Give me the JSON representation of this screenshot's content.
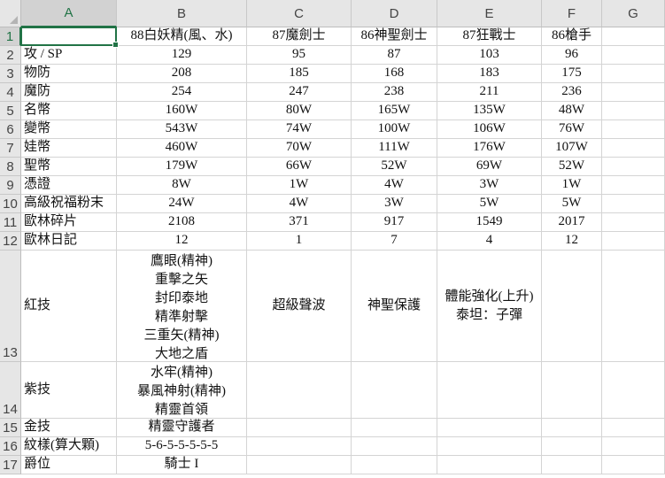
{
  "columns": [
    "A",
    "B",
    "C",
    "D",
    "E",
    "F",
    "G"
  ],
  "rows": [
    "1",
    "2",
    "3",
    "4",
    "5",
    "6",
    "7",
    "8",
    "9",
    "10",
    "11",
    "12",
    "13",
    "14",
    "15",
    "16",
    "17"
  ],
  "active_cell": "A1",
  "headers": [
    "",
    "88白妖精(風、水)",
    "87魔劍士",
    "86神聖劍士",
    "87狂戰士",
    "86槍手",
    ""
  ],
  "data_rows": [
    [
      "攻 / SP",
      "129",
      "95",
      "87",
      "103",
      "96",
      ""
    ],
    [
      "物防",
      "208",
      "185",
      "168",
      "183",
      "175",
      ""
    ],
    [
      "魔防",
      "254",
      "247",
      "238",
      "211",
      "236",
      ""
    ],
    [
      "名幣",
      "160W",
      "80W",
      "165W",
      "135W",
      "48W",
      ""
    ],
    [
      "變幣",
      "543W",
      "74W",
      "100W",
      "106W",
      "76W",
      ""
    ],
    [
      "娃幣",
      "460W",
      "70W",
      "111W",
      "176W",
      "107W",
      ""
    ],
    [
      "聖幣",
      "179W",
      "66W",
      "52W",
      "69W",
      "52W",
      ""
    ],
    [
      "憑證",
      "8W",
      "1W",
      "4W",
      "3W",
      "1W",
      ""
    ],
    [
      "高級祝福粉末",
      "24W",
      "4W",
      "3W",
      "5W",
      "5W",
      ""
    ],
    [
      "歐林碎片",
      "2108",
      "371",
      "917",
      "1549",
      "2017",
      ""
    ],
    [
      "歐林日記",
      "12",
      "1",
      "7",
      "4",
      "12",
      ""
    ]
  ],
  "skill_rows": [
    {
      "label": "紅技",
      "cells": [
        [
          "鷹眼(精神)",
          "重擊之矢",
          "封印泰地",
          "精準射擊",
          "三重矢(精神)",
          "大地之盾"
        ],
        [
          "超級聲波"
        ],
        [
          "神聖保護"
        ],
        [
          "體能強化(上升)",
          "泰坦：子彈"
        ],
        [],
        []
      ]
    },
    {
      "label": "紫技",
      "cells": [
        [
          "水牢(精神)",
          "暴風神射(精神)",
          "精靈首領"
        ],
        [],
        [],
        [],
        [],
        []
      ]
    }
  ],
  "tail_rows": [
    [
      "金技",
      "精靈守護者",
      "",
      "",
      "",
      "",
      ""
    ],
    [
      "紋樣(算大顆)",
      "5-6-5-5-5-5-5",
      "",
      "",
      "",
      "",
      ""
    ],
    [
      "爵位",
      "騎士 I",
      "",
      "",
      "",
      "",
      ""
    ]
  ]
}
